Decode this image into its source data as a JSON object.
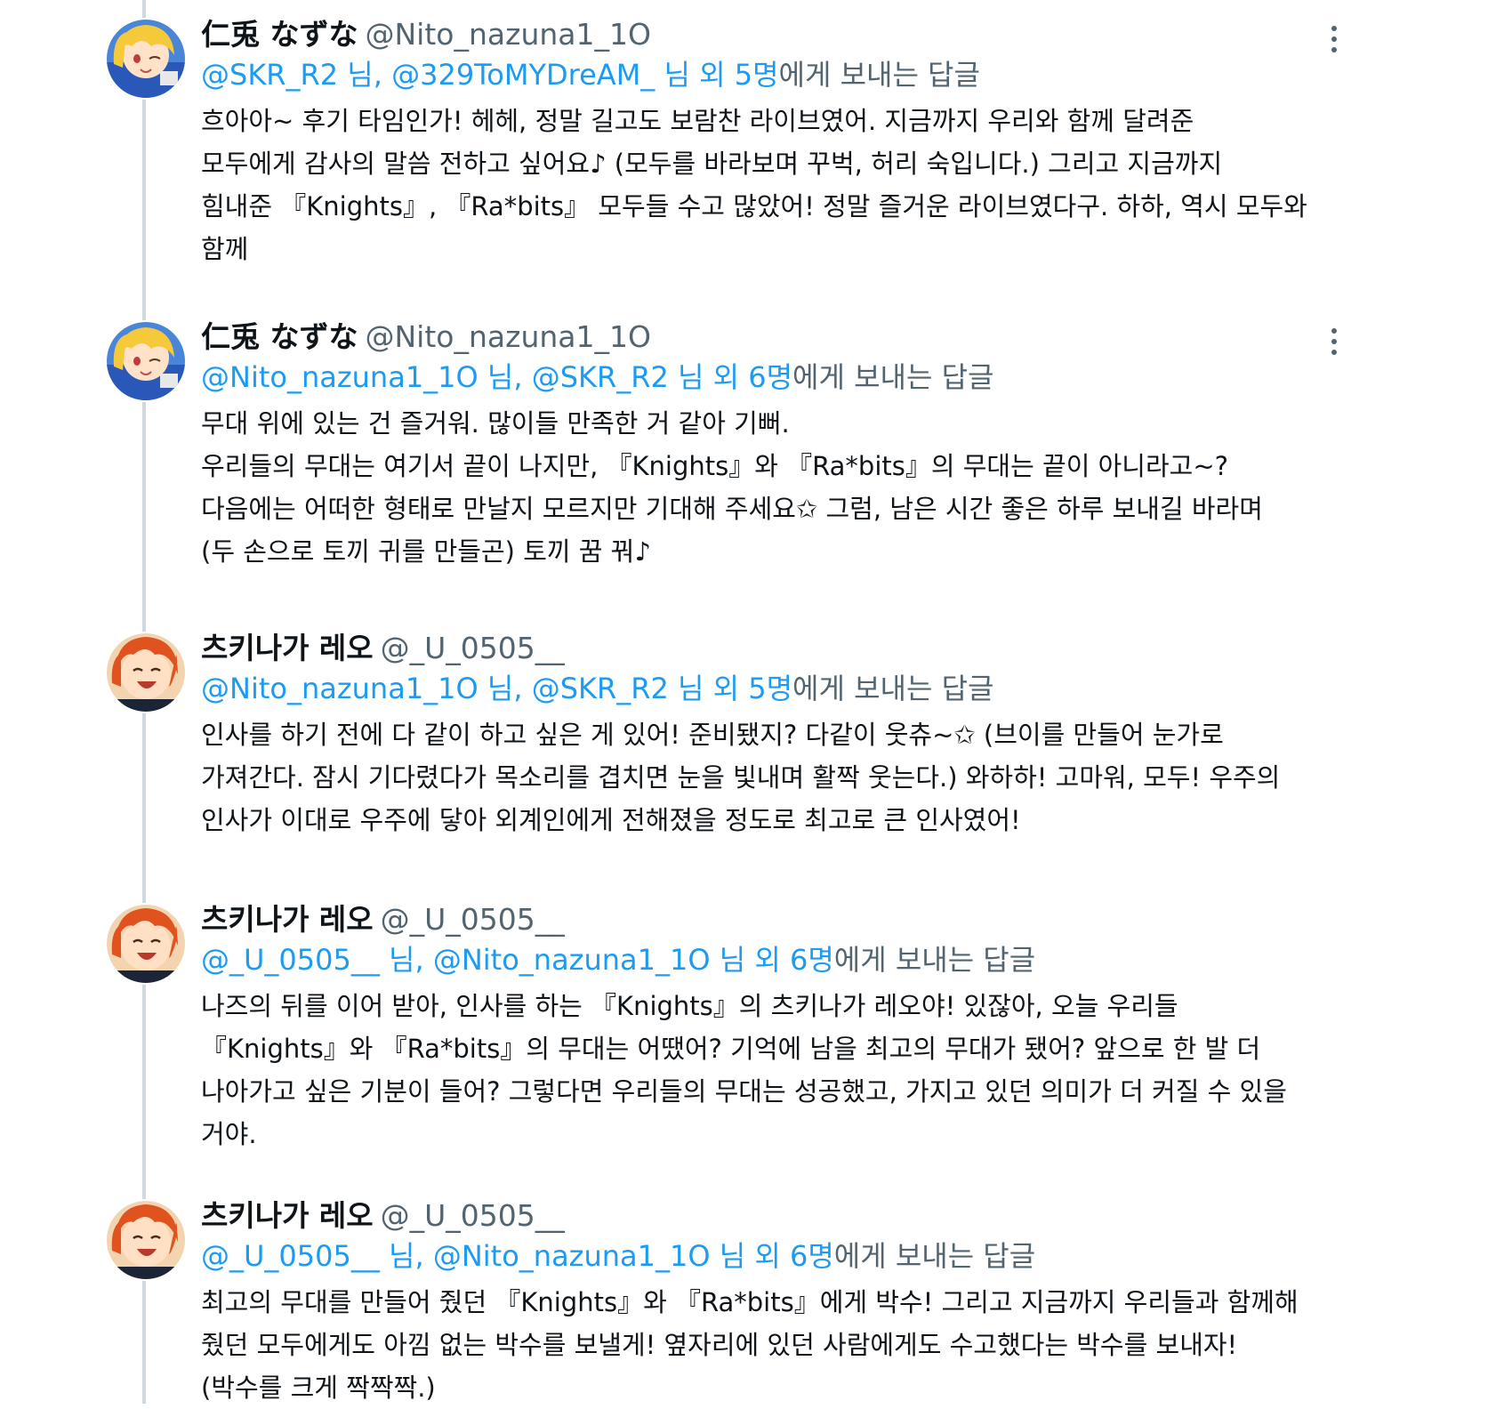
{
  "tweets": [
    {
      "author": {
        "name": "仁兎 なずな",
        "handle": "@Nito_nazuna1_1O"
      },
      "reply_to": {
        "first": "@SKR_R2",
        "sep1": " 님, ",
        "second": "@329ToMYDreAM_",
        "sep2": " 님 외 ",
        "count": "5명",
        "suffix": "에게 보내는 답글"
      },
      "lines": [
        "흐아아~ 후기 타임인가! 헤헤, 정말 길고도 보람찬 라이브였어. 지금까지 우리와 함께 달려준",
        "모두에게 감사의 말씀 전하고 싶어요♪ (모두를 바라보며 꾸벅, 허리 숙입니다.) 그리고 지금까지",
        "힘내준 『Knights』, 『Ra*bits』 모두들 수고 많았어! 정말 즐거운 라이브였다구. 하하, 역시 모두와",
        "함께"
      ]
    },
    {
      "author": {
        "name": "仁兎 なずな",
        "handle": "@Nito_nazuna1_1O"
      },
      "reply_to": {
        "first": "@Nito_nazuna1_1O",
        "sep1": " 님, ",
        "second": "@SKR_R2",
        "sep2": " 님 외 ",
        "count": "6명",
        "suffix": "에게 보내는 답글"
      },
      "lines": [
        "무대 위에 있는 건 즐거워. 많이들 만족한 거 같아 기뻐.",
        "우리들의 무대는 여기서 끝이 나지만, 『Knights』와 『Ra*bits』의 무대는 끝이 아니라고~?",
        "다음에는 어떠한 형태로 만날지 모르지만 기대해 주세요✩ 그럼, 남은 시간 좋은 하루 보내길 바라며",
        "(두 손으로 토끼 귀를 만들곤) 토끼 꿈 꿔♪"
      ]
    },
    {
      "author": {
        "name": "츠키나가 레오",
        "handle": "@_U_0505__"
      },
      "reply_to": {
        "first": "@Nito_nazuna1_1O",
        "sep1": " 님, ",
        "second": "@SKR_R2",
        "sep2": " 님 외 ",
        "count": "5명",
        "suffix": "에게 보내는 답글"
      },
      "lines": [
        "인사를 하기 전에 다 같이 하고 싶은 게 있어! 준비됐지? 다같이 웃츄~✩ (브이를 만들어 눈가로",
        "가져간다. 잠시 기다렸다가 목소리를 겹치면 눈을 빛내며 활짝 웃는다.) 와하하! 고마워, 모두! 우주의",
        "인사가 이대로 우주에 닿아 외계인에게 전해졌을 정도로 최고로 큰 인사였어!"
      ]
    },
    {
      "author": {
        "name": "츠키나가 레오",
        "handle": "@_U_0505__"
      },
      "reply_to": {
        "first": "@_U_0505__",
        "sep1": " 님, ",
        "second": "@Nito_nazuna1_1O",
        "sep2": " 님 외 ",
        "count": "6명",
        "suffix": "에게 보내는 답글"
      },
      "lines": [
        "나즈의 뒤를 이어 받아, 인사를 하는 『Knights』의 츠키나가 레오야! 있잖아, 오늘 우리들",
        "『Knights』와 『Ra*bits』의 무대는 어땠어? 기억에 남을 최고의 무대가 됐어? 앞으로 한 발 더",
        "나아가고 싶은 기분이 들어? 그렇다면 우리들의 무대는 성공했고, 가지고 있던 의미가 더 커질 수 있을",
        "거야."
      ]
    },
    {
      "author": {
        "name": "츠키나가 레오",
        "handle": "@_U_0505__"
      },
      "reply_to": {
        "first": "@_U_0505__",
        "sep1": " 님, ",
        "second": "@Nito_nazuna1_1O",
        "sep2": " 님 외 ",
        "count": "6명",
        "suffix": "에게 보내는 답글"
      },
      "lines": [
        "최고의 무대를 만들어 줬던 『Knights』와 『Ra*bits』에게 박수! 그리고 지금까지 우리들과 함께해",
        "줬던 모두에게도 아낌 없는 박수를 보낼게! 옆자리에 있던 사람에게도 수고했다는 박수를 보내자!",
        "(박수를 크게 짝짝짝.)"
      ]
    }
  ]
}
